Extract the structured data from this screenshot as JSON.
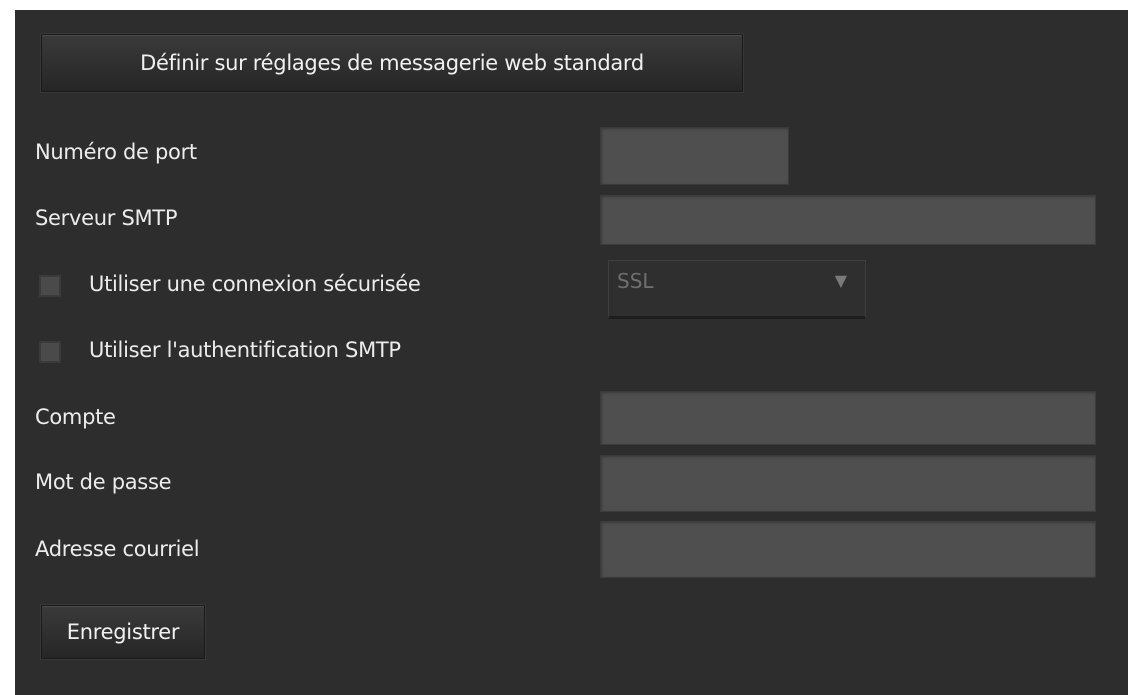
{
  "buttons": {
    "webmail_defaults": "Définir sur réglages de messagerie web standard",
    "save": "Enregistrer"
  },
  "labels": {
    "port": "Numéro de port",
    "smtp_server": "Serveur SMTP",
    "secure_connection": "Utiliser une connexion sécurisée",
    "smtp_auth": "Utiliser l'authentification SMTP",
    "account": "Compte",
    "password": "Mot de passe",
    "email": "Adresse courriel"
  },
  "fields": {
    "port": "",
    "smtp_server": "",
    "account": "",
    "password": "",
    "email": ""
  },
  "security_select": {
    "value": "SSL",
    "icon": "triangle-down-icon"
  },
  "checkboxes": {
    "secure_connection_checked": false,
    "smtp_auth_checked": false
  }
}
